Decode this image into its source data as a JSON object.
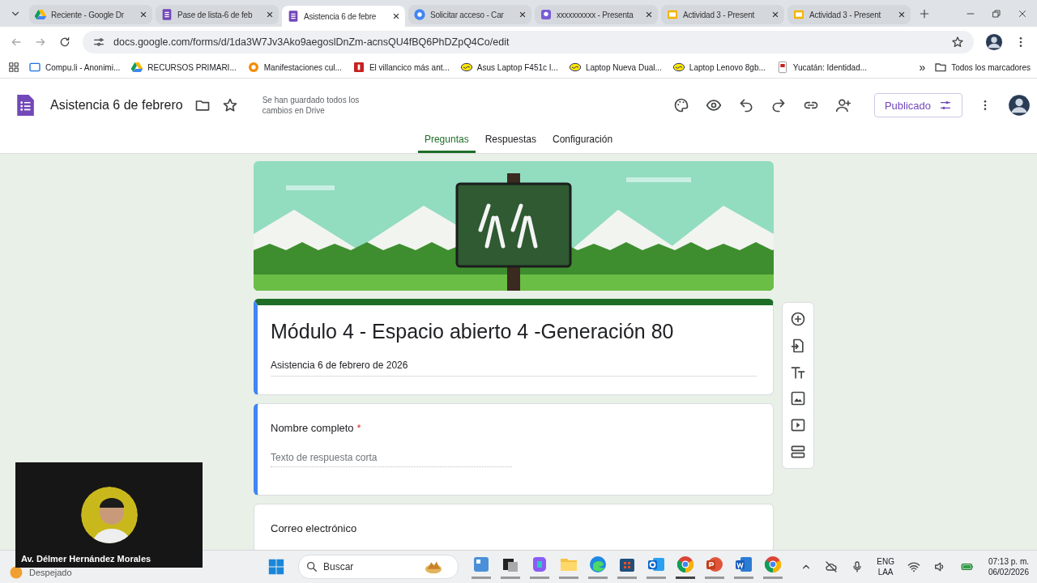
{
  "browser": {
    "tabs": [
      {
        "title": "Reciente - Google Dr",
        "kind": "drive",
        "selected": false
      },
      {
        "title": "Pase de lista-6 de feb",
        "kind": "forms",
        "selected": false
      },
      {
        "title": "Asistencia 6 de febre",
        "kind": "forms",
        "selected": true
      },
      {
        "title": "Solicitar acceso - Car",
        "kind": "chrome",
        "selected": false
      },
      {
        "title": "xxxxxxxxxx - Presenta",
        "kind": "meet",
        "selected": false
      },
      {
        "title": "Actividad 3 - Present",
        "kind": "slides",
        "selected": false
      },
      {
        "title": "Actividad 3 - Present",
        "kind": "slides",
        "selected": false
      }
    ],
    "url": "docs.google.com/forms/d/1da3W7Jv3Ako9aegoslDnZm-acnsQU4fBQ6PhDZpQ4Co/edit",
    "bookmarks": [
      {
        "label": "Compu.li - Anonimi...",
        "kind": "page"
      },
      {
        "label": "RECURSOS PRIMARI...",
        "kind": "drive"
      },
      {
        "label": "Manifestaciones cul...",
        "kind": "orange"
      },
      {
        "label": "El villancico más ant...",
        "kind": "red"
      },
      {
        "label": "Asus Laptop F451c I...",
        "kind": "ml"
      },
      {
        "label": "Laptop Nueva Dual...",
        "kind": "ml"
      },
      {
        "label": "Laptop Lenovo 8gb...",
        "kind": "ml"
      },
      {
        "label": "Yucatán: Identidad...",
        "kind": "doc"
      }
    ],
    "more": "»",
    "all_bookmarks": "Todos los marcadores"
  },
  "forms_header": {
    "doc_title": "Asistencia 6 de febrero",
    "save_status": "Se han guardado todos los cambios en Drive",
    "publish_button": "Publicado",
    "tabs": [
      {
        "label": "Preguntas",
        "selected": true
      },
      {
        "label": "Respuestas",
        "selected": false
      },
      {
        "label": "Configuración",
        "selected": false
      }
    ]
  },
  "form": {
    "title": "Módulo 4 - Espacio abierto 4 -Generación 80",
    "description": "Asistencia 6 de febrero de 2026",
    "questions": [
      {
        "label": "Nombre completo",
        "required_mark": "*",
        "placeholder": "Texto de respuesta corta",
        "selected": true
      },
      {
        "label": "Correo electrónico",
        "selected": false
      }
    ]
  },
  "webcam": {
    "name": "Av. Délmer Hernández Morales"
  },
  "taskbar": {
    "weather": "Despejado",
    "search_placeholder": "Buscar",
    "apps": [
      {
        "kind": "widgets",
        "active": false
      },
      {
        "kind": "taskview",
        "active": false
      },
      {
        "kind": "copilot",
        "active": false
      },
      {
        "kind": "folder",
        "active": false
      },
      {
        "kind": "edge",
        "active": false
      },
      {
        "kind": "store",
        "active": false
      },
      {
        "kind": "outlook",
        "active": false
      },
      {
        "kind": "chrome",
        "active": true
      },
      {
        "kind": "powerpoint",
        "active": false
      },
      {
        "kind": "word",
        "active": false
      },
      {
        "kind": "chrome",
        "active": false
      }
    ],
    "language": "ENG",
    "layout": "LAA",
    "time": "07:13 p. m.",
    "date": "06/02/2026"
  }
}
